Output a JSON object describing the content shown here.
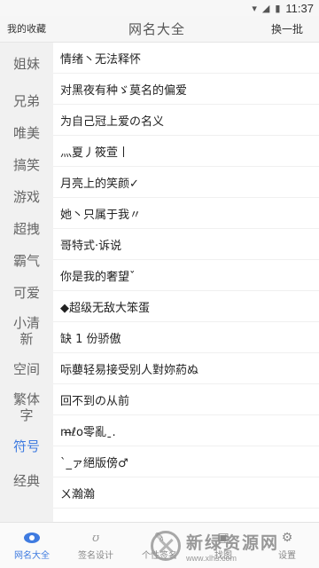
{
  "status_bar": {
    "time": "11:37",
    "icons": [
      "wifi-icon",
      "signal-icon",
      "battery-icon"
    ]
  },
  "header": {
    "favorites_label": "我的收藏",
    "title": "网名大全",
    "refresh_label": "换一批"
  },
  "sidebar": {
    "items": [
      {
        "label": "姐妹"
      },
      {
        "label": "兄弟"
      },
      {
        "label": "唯美"
      },
      {
        "label": "搞笑"
      },
      {
        "label": "游戏"
      },
      {
        "label": "超拽"
      },
      {
        "label": "霸气"
      },
      {
        "label": "可爱"
      },
      {
        "label": "小清新"
      },
      {
        "label": "空间"
      },
      {
        "label": "繁体字"
      },
      {
        "label": "符号"
      },
      {
        "label": "经典"
      }
    ],
    "active": "符号"
  },
  "names": [
    "情绪丶无法释怀",
    "对黑夜有种ゞ莫名的偏爱",
    "为自己冠上爱の名义",
    "灬夏丿筱萱丨",
    "月亮上的笑颜✓",
    "她丶只属于我〃",
    "哥特式·诉说",
    "你是我的奢望ˇ",
    "◆超级无敌大笨蛋",
    "缺 1 份骄傲",
    "呩蘡轻易接受别人對妳葯ぬ",
    "回不到の从前",
    "m̶ℓo零亂ˍ.",
    "`_ァ絕版傍♂",
    "ㄨ瀚瀚"
  ],
  "bottom_nav": [
    {
      "label": "网名大全",
      "icon": "eye-icon",
      "active": true
    },
    {
      "label": "签名设计",
      "icon": "signature-icon"
    },
    {
      "label": "个性签名",
      "icon": "pen-icon"
    },
    {
      "label": "找图",
      "icon": "image-icon"
    },
    {
      "label": "设置",
      "icon": "gear-icon"
    }
  ],
  "watermark": {
    "text": "新绿资源网",
    "url": "www.xlhs.com"
  },
  "colors": {
    "accent": "#3f7be0",
    "sidebar_bg": "#f1f1f1"
  }
}
